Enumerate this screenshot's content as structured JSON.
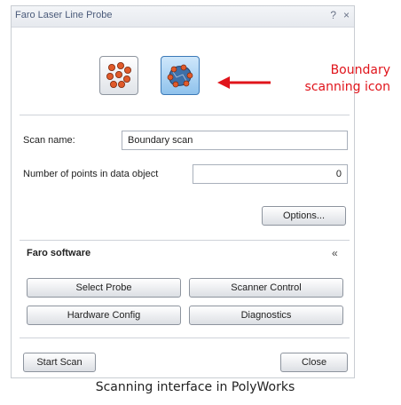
{
  "window": {
    "title": "Faro Laser Line Probe",
    "help_glyph": "?",
    "close_glyph": "×"
  },
  "modes": [
    {
      "icon": "point-scanning-icon",
      "active": false
    },
    {
      "icon": "boundary-scanning-icon",
      "active": true
    }
  ],
  "annotation": {
    "line1": "Boundary",
    "line2": "scanning icon",
    "color": "#e0141b"
  },
  "form": {
    "scan_name_label": "Scan name:",
    "scan_name_value": "Boundary scan",
    "points_label": "Number of points in data object",
    "points_value": "0",
    "options_label": "Options..."
  },
  "faro_section": {
    "title": "Faro software",
    "collapse_glyph": "«",
    "buttons": [
      "Select Probe",
      "Scanner Control",
      "Hardware Config",
      "Diagnostics"
    ]
  },
  "footer": {
    "start_label": "Start Scan",
    "close_label": "Close"
  },
  "caption": "Scanning interface in PolyWorks"
}
